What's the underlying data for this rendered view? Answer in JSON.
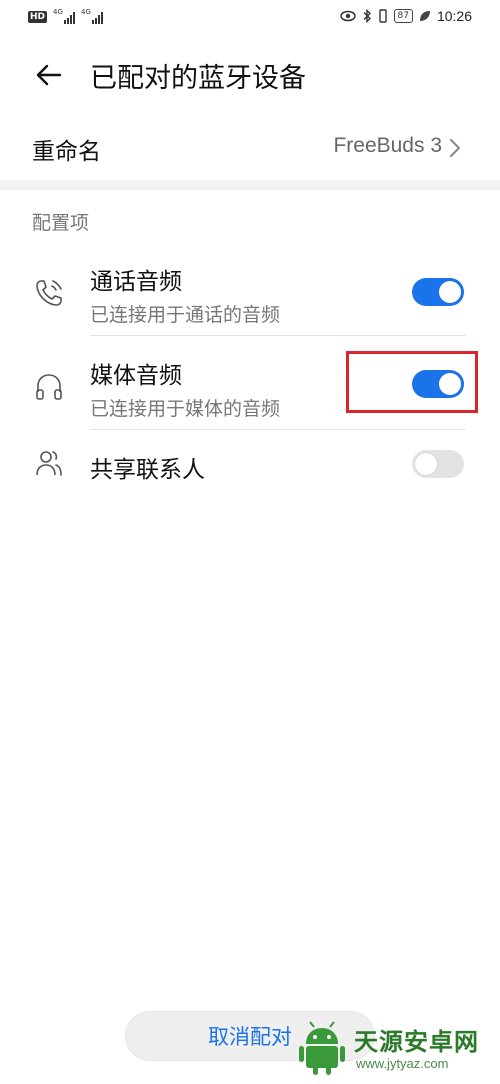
{
  "status_bar": {
    "hd_label": "HD",
    "net1": "4G",
    "net2": "4G",
    "battery": "87",
    "time": "10:26"
  },
  "header": {
    "back_icon": "arrow-left-icon",
    "title": "已配对的蓝牙设备"
  },
  "rename": {
    "label": "重命名",
    "value": "FreeBuds 3"
  },
  "section": {
    "title": "配置项"
  },
  "items": [
    {
      "icon": "phone-call-icon",
      "label": "通话音频",
      "sub": "已连接用于通话的音频",
      "enabled": true
    },
    {
      "icon": "headphones-icon",
      "label": "媒体音频",
      "sub": "已连接用于媒体的音频",
      "enabled": true
    },
    {
      "icon": "contacts-icon",
      "label": "共享联系人",
      "sub": "",
      "enabled": false
    }
  ],
  "footer": {
    "unpair_label": "取消配对"
  },
  "watermark": {
    "name": "天源安卓网",
    "url": "www.jytyaz.com"
  },
  "colors": {
    "accent": "#1a73e8",
    "highlight": "#d9262b",
    "toggle_off": "#e3e3e3"
  }
}
